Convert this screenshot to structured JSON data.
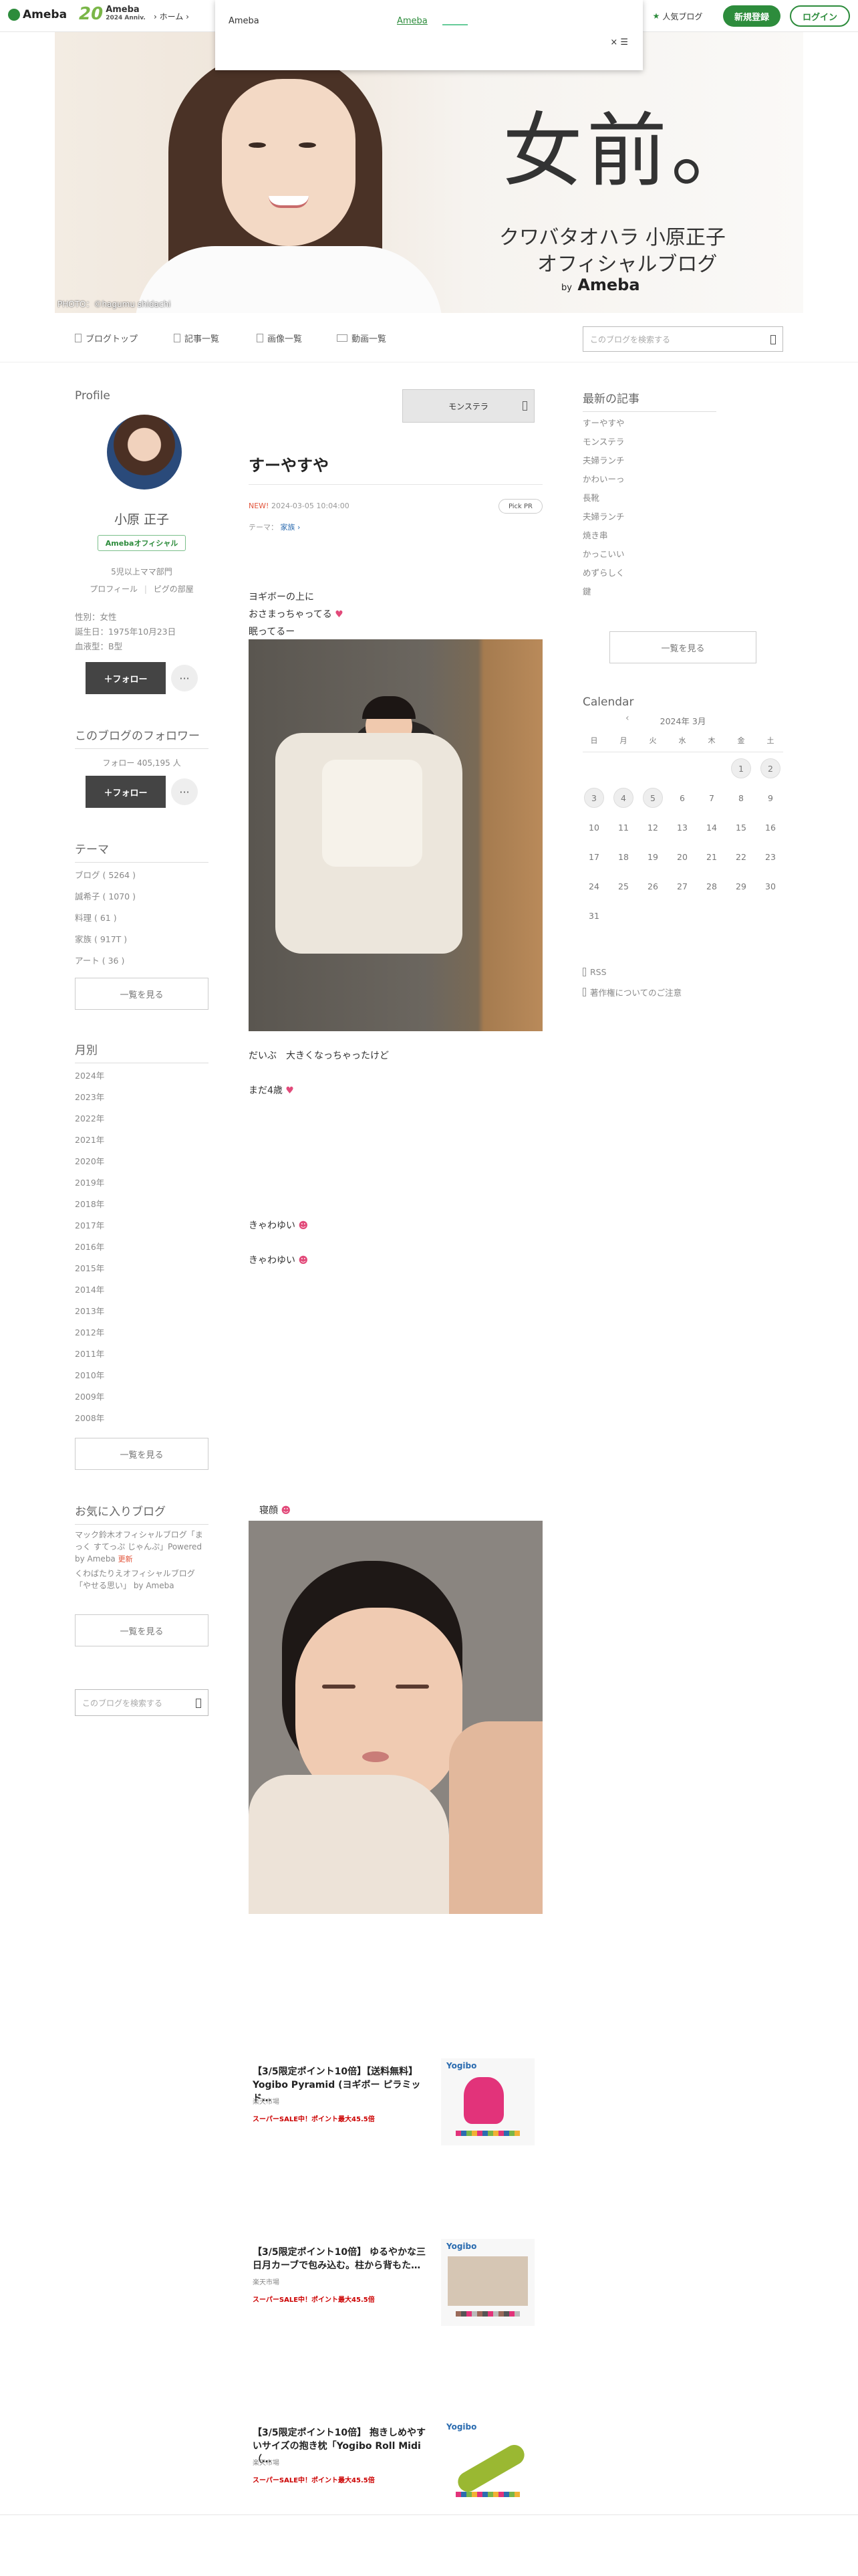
{
  "header": {
    "logo": "Ameba",
    "anniv_num": "20",
    "anniv_brand": "Ameba",
    "anniv_since": "2024 Anniv.",
    "breadcrumb": "› ホーム ›",
    "popup_brand": "Ameba",
    "popup_link": "Ameba",
    "popup_close": "× ☰",
    "ranking": "人気ブログ",
    "signup": "新規登録",
    "login": "ログイン"
  },
  "banner": {
    "title": "女前。",
    "subtitle1": "クワバタオハラ 小原正子",
    "subtitle2": "オフィシャルブログ",
    "by": "by",
    "by_brand": "Ameba",
    "credit": "PHOTO：©hagumu shidachi"
  },
  "nav": {
    "items": [
      "ブログトップ",
      "記事一覧",
      "画像一覧",
      "動画一覧"
    ],
    "search_placeholder": "このブログを検索する"
  },
  "profile": {
    "heading": "Profile",
    "name": "小原 正子",
    "badge": "Amebaオフィシャル",
    "tag": "5児以上ママ部門",
    "link_profile": "プロフィール",
    "link_room": "ピグの部屋",
    "gender": "性別：女性",
    "birthday": "誕生日：1975年10月23日",
    "blood": "血液型：B型",
    "follow": "＋フォロー",
    "more": "···"
  },
  "followers": {
    "heading": "このブログのフォロワー",
    "count": "フォロー 405,195 人",
    "follow": "＋フォロー",
    "more": "···"
  },
  "themes": {
    "heading": "テーマ",
    "items": [
      "ブログ ( 5264 )",
      "誠希子 ( 1070 )",
      "料理 ( 61 )",
      "家族 ( 917T )",
      "アート ( 36 )"
    ],
    "more": "一覧を見る"
  },
  "archive": {
    "heading": "月別",
    "years": [
      "2024年",
      "2023年",
      "2022年",
      "2021年",
      "2020年",
      "2019年",
      "2018年",
      "2017年",
      "2016年",
      "2015年",
      "2014年",
      "2013年",
      "2012年",
      "2011年",
      "2010年",
      "2009年",
      "2008年"
    ],
    "more": "一覧を見る"
  },
  "favorites": {
    "heading": "お気に入りブログ",
    "item1": "マック鈴木オフィシャルブログ「まっく すてっぷ じゃんぷ」Powered by Ameba",
    "item1_badge": "更新",
    "item2": "くわばたりえオフィシャルブログ「やせる思い」 by Ameba",
    "more": "一覧を見る",
    "search_placeholder": "このブログを検索する"
  },
  "article": {
    "ad_label": "モンステラ",
    "title": "すーやすや",
    "new_badge": "NEW!",
    "datetime": "2024-03-05 10:04:00",
    "theme_label": "テーマ：",
    "theme": "家族",
    "pick": "Pick PR",
    "line1": "ヨギボーの上に",
    "line2": "おさまっちゃってる",
    "line3": "眠ってるー",
    "line4": "だいぶ　大きくなっちゃったけど",
    "line5": "まだ4歳",
    "line6": "きゃわゆい",
    "line7": "きゃわゆい",
    "line8": "寝顔"
  },
  "ads": [
    {
      "title": "【3/5限定ポイント10倍】【送料無料】Yogibo Pyramid (ヨギボー ピラミッド…",
      "seller": "楽天市場",
      "sale": "スーパーSALE中！ポイント最大45.5倍",
      "brand": "Yogibo"
    },
    {
      "title": "【3/5限定ポイント10倍】 ゆるやかな三日月カーブで包み込む。柱から背もた…",
      "seller": "楽天市場",
      "sale": "スーパーSALE中！ポイント最大45.5倍",
      "brand": "Yogibo"
    },
    {
      "title": "【3/5限定ポイント10倍】 抱きしめやすいサイズの抱き枕「Yogibo Roll Midi（…",
      "seller": "楽天市場",
      "sale": "スーパーSALE中！ポイント最大45.5倍",
      "brand": "Yogibo"
    }
  ],
  "recent": {
    "heading": "最新の記事",
    "items": [
      "すーやすや",
      "モンステラ",
      "夫婦ランチ",
      "かわいーっ",
      "長靴",
      "夫婦ランチ",
      "焼き串",
      "かっこいい",
      "めずらしく",
      "鍵"
    ],
    "more": "一覧を見る"
  },
  "calendar": {
    "heading": "Calendar",
    "month": "2024年 3月",
    "prev": "‹",
    "weekdays": [
      "日",
      "月",
      "火",
      "水",
      "木",
      "金",
      "土"
    ],
    "rows": [
      [
        "",
        "",
        "",
        "",
        "",
        "1",
        "2"
      ],
      [
        "3",
        "4",
        "5",
        "6",
        "7",
        "8",
        "9"
      ],
      [
        "10",
        "11",
        "12",
        "13",
        "14",
        "15",
        "16"
      ],
      [
        "17",
        "18",
        "19",
        "20",
        "21",
        "22",
        "23"
      ],
      [
        "24",
        "25",
        "26",
        "27",
        "28",
        "29",
        "30"
      ],
      [
        "31",
        "",
        "",
        "",
        "",
        "",
        ""
      ]
    ],
    "posted_days": [
      "1",
      "2",
      "3",
      "4",
      "5"
    ]
  },
  "footer_links": {
    "rss": "RSS",
    "copyright": "著作権についてのご注意"
  },
  "colors": {
    "brand_green": "#2d8c3c",
    "heart_pink": "#e24a7a",
    "new_red": "#e2553c",
    "sale_red": "#cc0000"
  }
}
